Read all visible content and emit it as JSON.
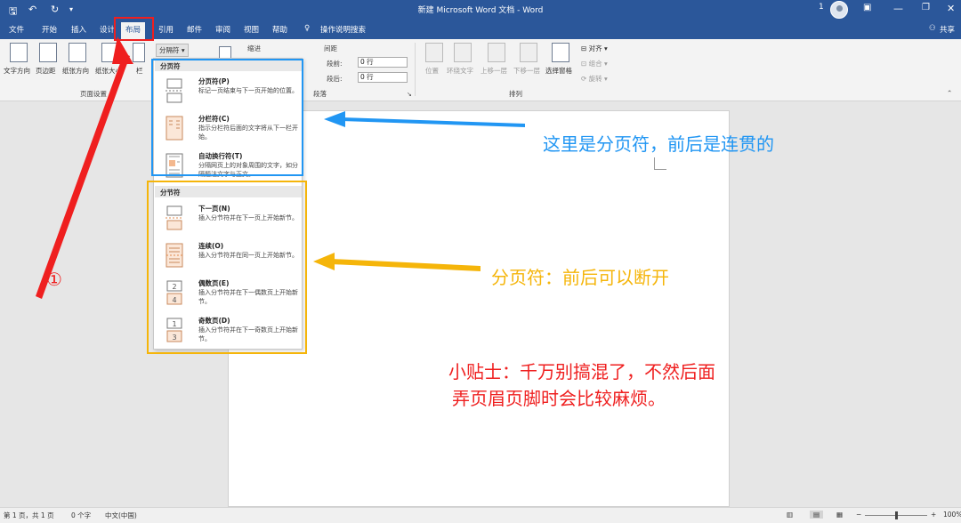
{
  "window": {
    "title": "新建 Microsoft Word 文档 - Word",
    "user_badge": "1",
    "share_label": "共享"
  },
  "tabs": [
    "文件",
    "开始",
    "插入",
    "设计",
    "布局",
    "引用",
    "邮件",
    "审阅",
    "视图",
    "帮助"
  ],
  "tell_me": "操作说明搜索",
  "ribbon": {
    "buttons": [
      "文字方向",
      "页边距",
      "纸张方向",
      "纸张大小",
      "栏"
    ],
    "breaks_button": "分隔符",
    "page_setup_group": "页面设置",
    "indent_label": "缩进",
    "spacing_label": "间距",
    "before_label": "段前:",
    "before_value": "0 行",
    "after_label": "段后:",
    "after_value": "0 行",
    "paragraph_group": "段落",
    "arrange_buttons": [
      "位置",
      "环绕文字",
      "上移一层",
      "下移一层",
      "选择窗格"
    ],
    "align_label": "对齐",
    "group_label": "组合",
    "rotate_label": "旋转",
    "arrange_group": "排列"
  },
  "dropdown": {
    "page_breaks_header": "分页符",
    "section_breaks_header": "分节符",
    "page_items": [
      {
        "title": "分页符(P)",
        "desc": "标记一页结束与下一页开始的位置。"
      },
      {
        "title": "分栏符(C)",
        "desc": "指示分栏符后面的文字将从下一栏开始。"
      },
      {
        "title": "自动换行符(T)",
        "desc": "分隔网页上的对象周围的文字，如分隔题注文字与正文。"
      }
    ],
    "section_items": [
      {
        "title": "下一页(N)",
        "desc": "插入分节符并在下一页上开始新节。"
      },
      {
        "title": "连续(O)",
        "desc": "插入分节符并在同一页上开始新节。"
      },
      {
        "title": "偶数页(E)",
        "desc": "插入分节符并在下一偶数页上开始新节。"
      },
      {
        "title": "奇数页(D)",
        "desc": "插入分节符并在下一奇数页上开始新节。"
      }
    ]
  },
  "annotations": {
    "circle_marker": "①",
    "blue_note": "这里是分页符，前后是连贯的",
    "orange_note": "分页符：前后可以断开",
    "tip_line1": "小贴士：千万别搞混了，不然后面",
    "tip_line2": "弄页眉页脚时会比较麻烦。",
    "colors": {
      "blue": "#2196f3",
      "orange": "#f5b50a",
      "red": "#ef1f1f"
    }
  },
  "status": {
    "page": "第 1 页，共 1 页",
    "words": "0 个字",
    "language": "中文(中国)",
    "zoom": "100%"
  }
}
